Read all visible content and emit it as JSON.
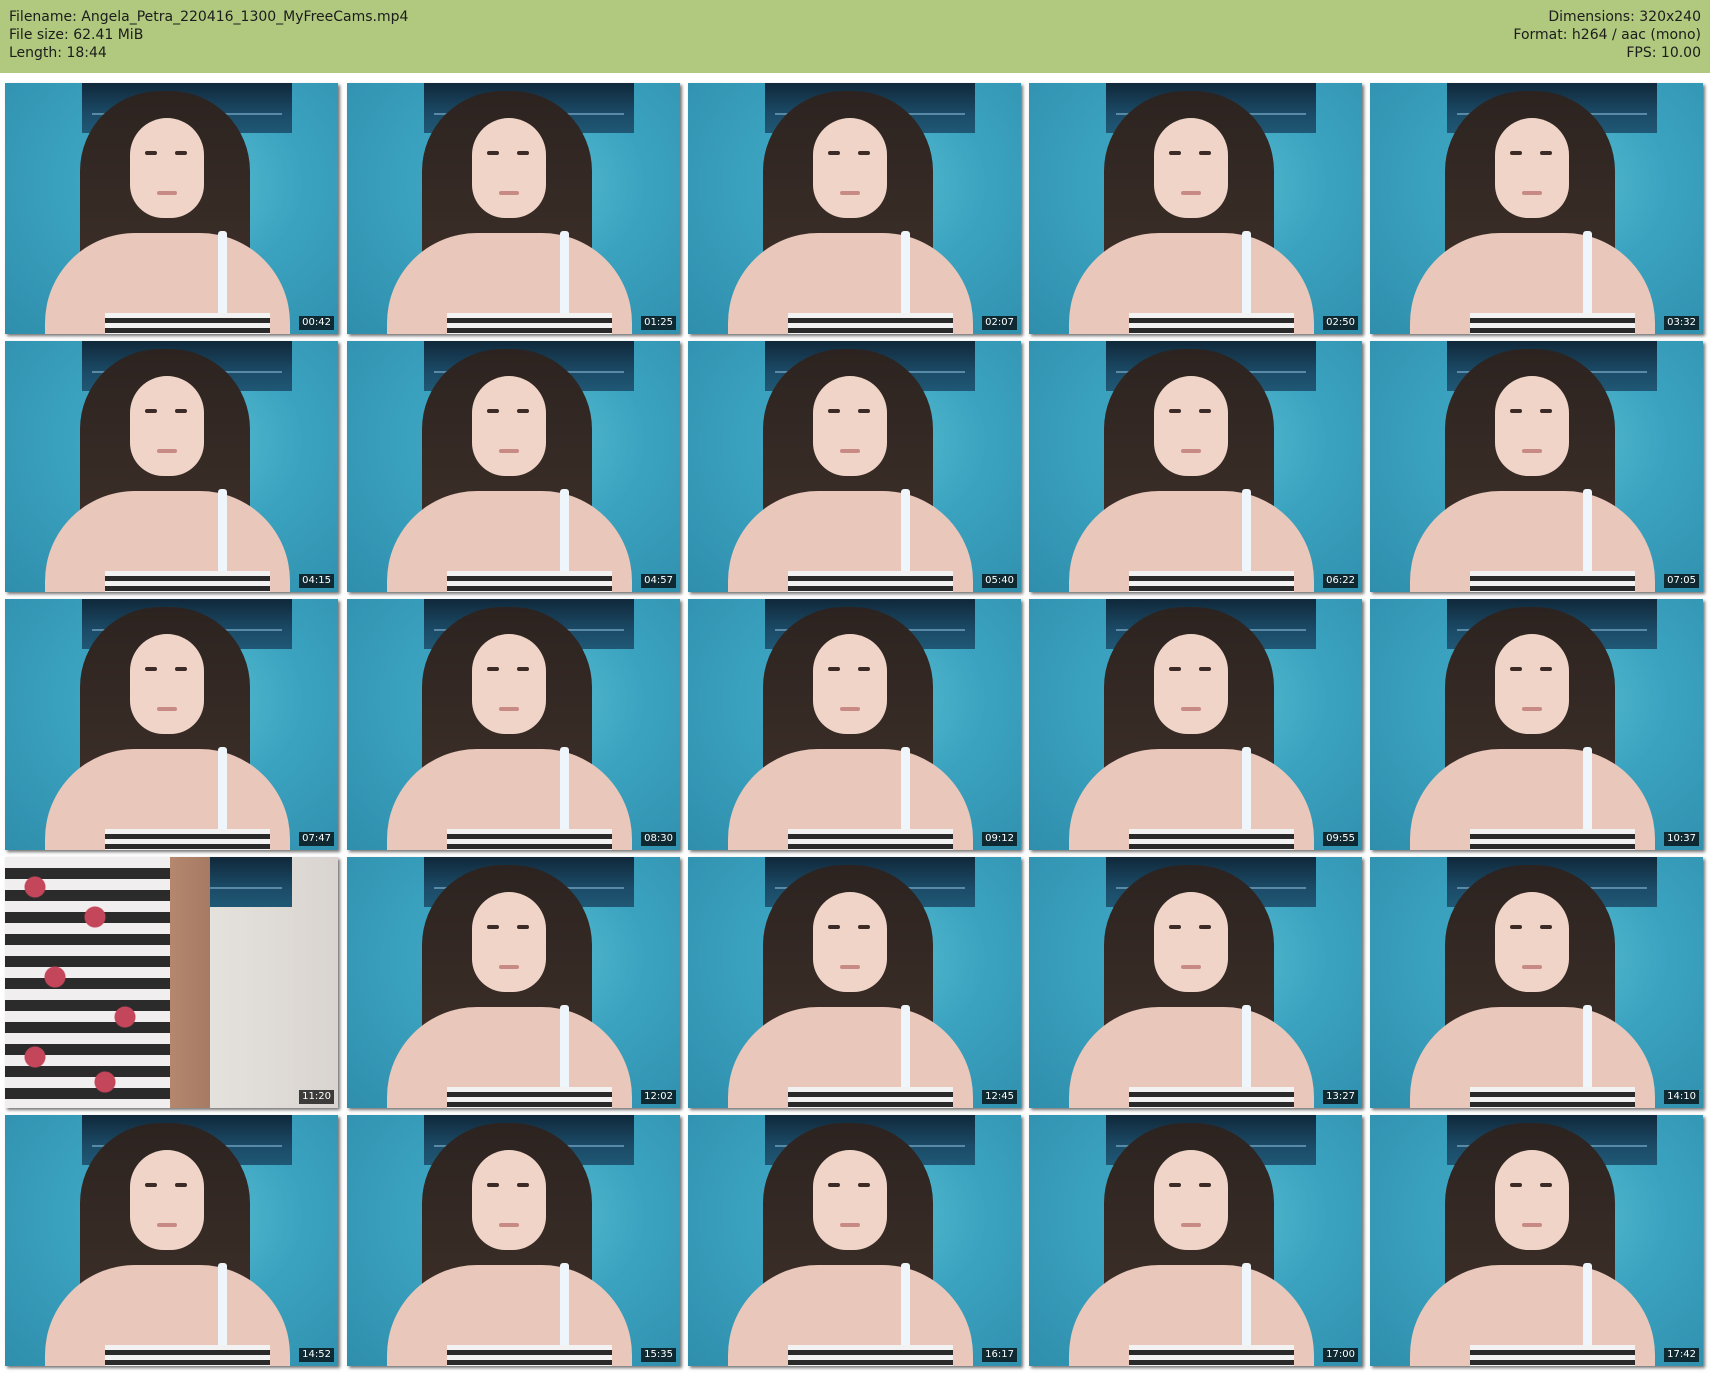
{
  "header": {
    "filename": "Filename: Angela_Petra_220416_1300_MyFreeCams.mp4",
    "file_size": "File size: 62.41 MiB",
    "length": "Length: 18:44",
    "dimensions": "Dimensions: 320x240",
    "format": "Format: h264 / aac (mono)",
    "fps": "FPS: 10.00",
    "background_color": "#b0c97e"
  },
  "thumbnails": [
    {
      "timestamp": "00:42"
    },
    {
      "timestamp": "01:25"
    },
    {
      "timestamp": "02:07"
    },
    {
      "timestamp": "02:50"
    },
    {
      "timestamp": "03:32"
    },
    {
      "timestamp": "04:15"
    },
    {
      "timestamp": "04:57"
    },
    {
      "timestamp": "05:40"
    },
    {
      "timestamp": "06:22"
    },
    {
      "timestamp": "07:05"
    },
    {
      "timestamp": "07:47"
    },
    {
      "timestamp": "08:30"
    },
    {
      "timestamp": "09:12"
    },
    {
      "timestamp": "09:55"
    },
    {
      "timestamp": "10:37"
    },
    {
      "timestamp": "11:20"
    },
    {
      "timestamp": "12:02"
    },
    {
      "timestamp": "12:45"
    },
    {
      "timestamp": "13:27"
    },
    {
      "timestamp": "14:10"
    },
    {
      "timestamp": "14:52"
    },
    {
      "timestamp": "15:35"
    },
    {
      "timestamp": "16:17"
    },
    {
      "timestamp": "17:00"
    },
    {
      "timestamp": "17:42"
    }
  ]
}
